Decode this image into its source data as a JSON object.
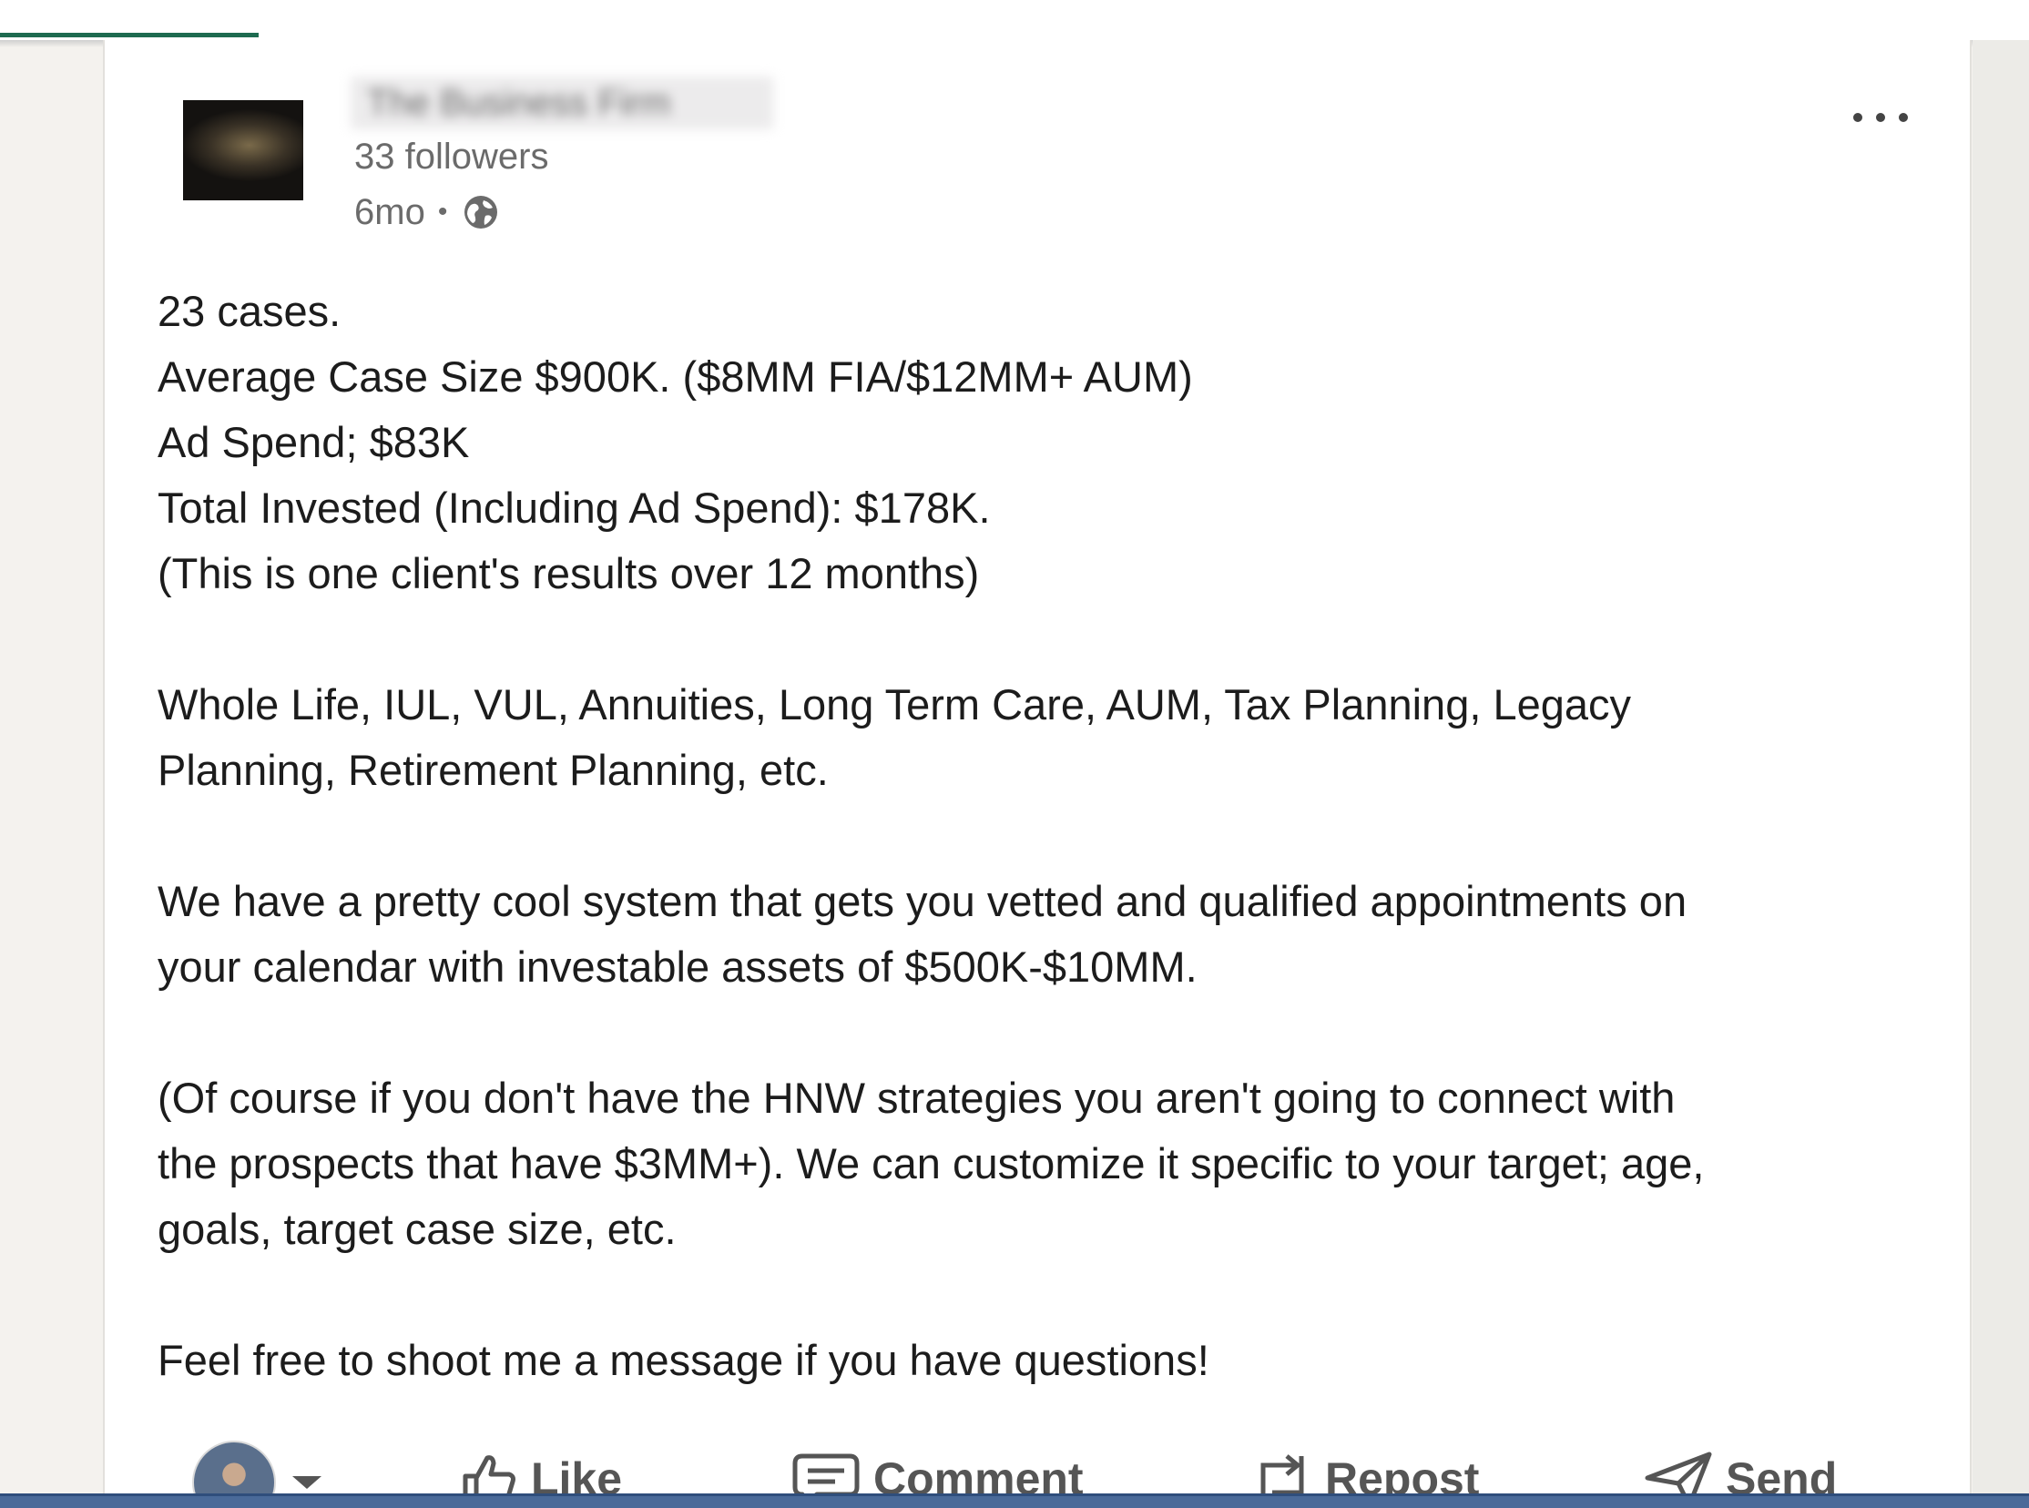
{
  "post": {
    "author": {
      "name": "The Business Firm",
      "followers": "33 followers",
      "posted_ago": "6mo",
      "separator": "•",
      "visibility_icon": "globe-icon"
    },
    "more_menu_icon": "ellipsis-icon",
    "body_lines": [
      "23 cases.",
      "Average Case Size $900K. ($8MM FIA/$12MM+ AUM)",
      "Ad Spend; $83K",
      "Total Invested (Including Ad Spend): $178K.",
      "(This is one client's results over 12 months)",
      "",
      "Whole Life, IUL, VUL, Annuities, Long Term Care, AUM, Tax Planning, Legacy",
      "Planning, Retirement Planning, etc.",
      "",
      "We have a pretty cool system that gets you vetted and qualified appointments on",
      "your calendar with investable assets of $500K-$10MM.",
      "",
      "(Of course if you don't have the HNW strategies you aren't going to connect with",
      "the prospects that have $3MM+). We can customize it specific to your target; age,",
      "goals, target case size, etc.",
      "",
      "Feel free to shoot me a message if you have questions!"
    ]
  },
  "actions": {
    "like": "Like",
    "comment": "Comment",
    "repost": "Repost",
    "send": "Send"
  },
  "colors": {
    "accent_green": "#1e6b50",
    "text_primary": "#1c1c1c",
    "text_secondary": "#6b6b6b",
    "bottom_bar": "#4a6a99"
  }
}
